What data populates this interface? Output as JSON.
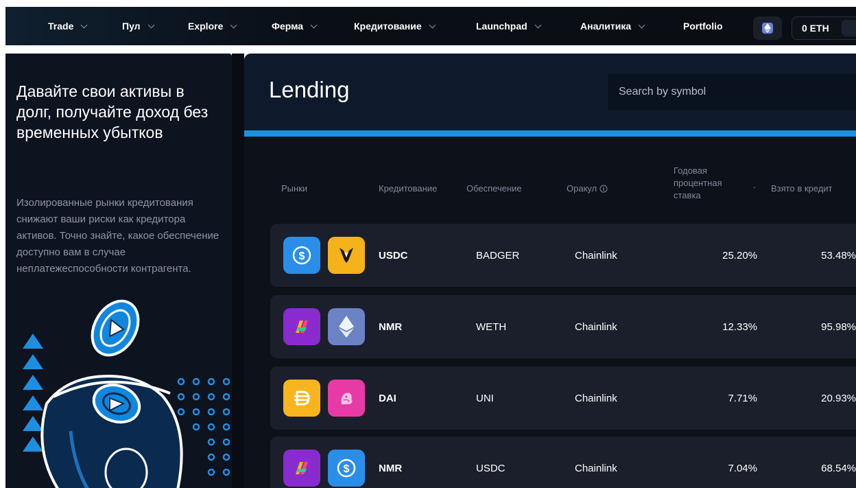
{
  "nav": {
    "items": [
      {
        "label": "Trade"
      },
      {
        "label": "Пул"
      },
      {
        "label": "Explore"
      },
      {
        "label": "Ферма"
      },
      {
        "label": "Кредитование"
      },
      {
        "label": "Launchpad"
      },
      {
        "label": "Аналитика"
      },
      {
        "label": "Portfolio"
      }
    ],
    "wallet_balance": "0 ETH"
  },
  "left_panel": {
    "title": "Давайте свои активы в долг, получайте доход без временных убытков",
    "description": "Изолированные рынки кредитования снижают ваши риски как кредитора активов. Точно знайте, какое обеспечение доступно вам в случае неплатежеспособности контрагента."
  },
  "main": {
    "title": "Lending",
    "search_placeholder": "Search by symbol",
    "columns": {
      "markets": "Рынки",
      "lending": "Кредитование",
      "collateral": "Обеспечение",
      "oracle": "Оракул",
      "apr": "Годовая процентная ставка",
      "borrowed": "Взято в кредит"
    },
    "rows": [
      {
        "lending": "USDC",
        "collateral": "BADGER",
        "oracle": "Chainlink",
        "apr": "25.20%",
        "borrowed": "53.48%",
        "icons": [
          "usdc-icon",
          "badger-icon"
        ]
      },
      {
        "lending": "NMR",
        "collateral": "WETH",
        "oracle": "Chainlink",
        "apr": "12.33%",
        "borrowed": "95.98%",
        "icons": [
          "nmr-icon",
          "weth-icon"
        ]
      },
      {
        "lending": "DAI",
        "collateral": "UNI",
        "oracle": "Chainlink",
        "apr": "7.71%",
        "borrowed": "20.93%",
        "icons": [
          "dai-icon",
          "uni-icon"
        ]
      },
      {
        "lending": "NMR",
        "collateral": "USDC",
        "oracle": "Chainlink",
        "apr": "7.04%",
        "borrowed": "68.54%",
        "icons": [
          "nmr-icon",
          "usdc-icon"
        ]
      }
    ]
  },
  "colors": {
    "accent_blue": "#1e90e2",
    "usdc": "#2a8ee8",
    "badger": "#f6b21a",
    "nmr": "#8a2bd0",
    "weth": "#6b82c4",
    "dai": "#f8b51e",
    "uni": "#e83aa4"
  }
}
